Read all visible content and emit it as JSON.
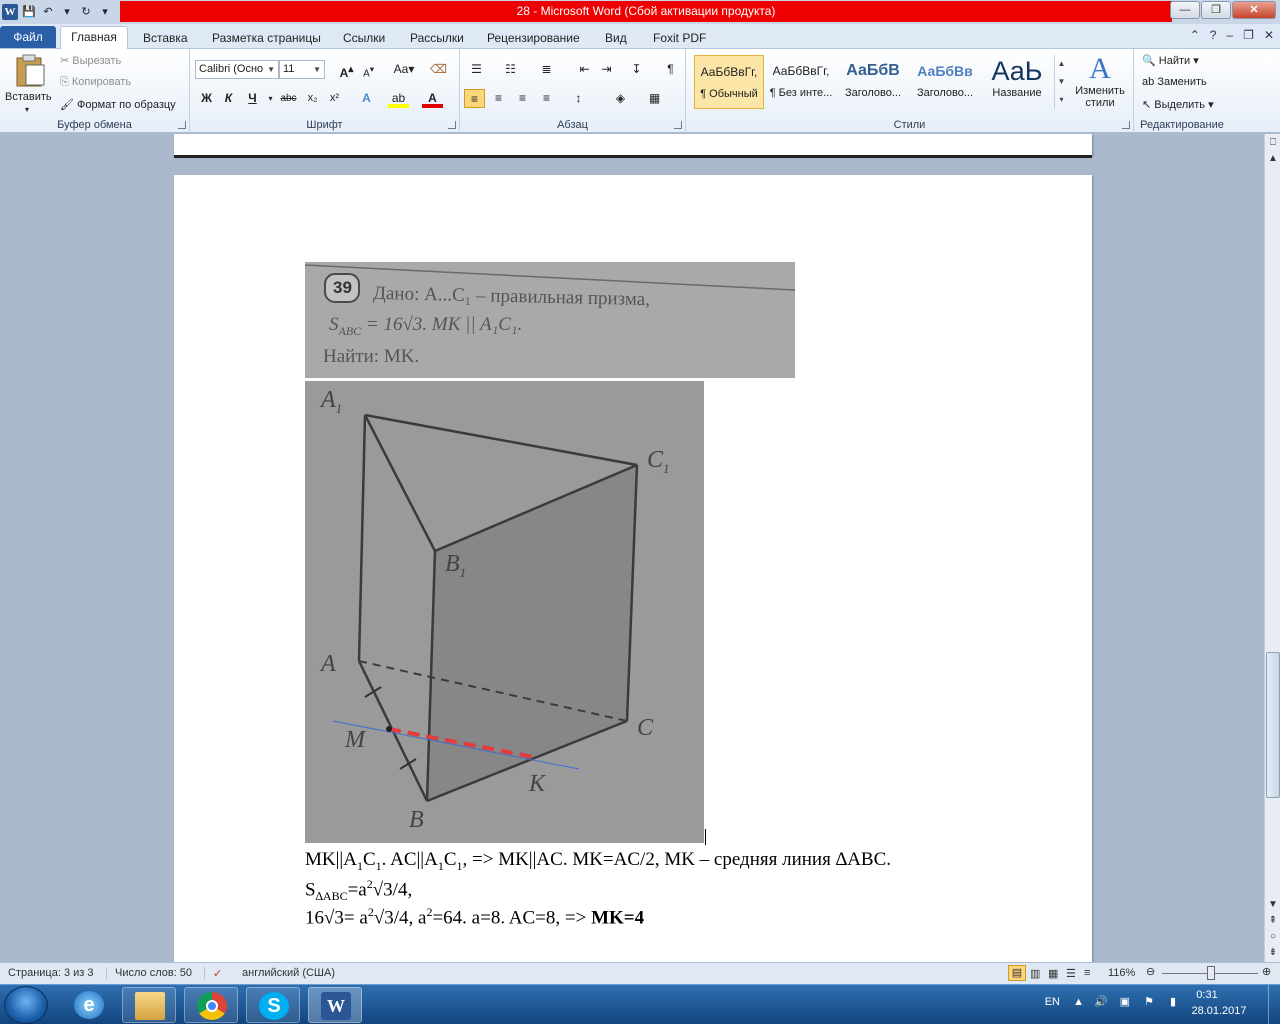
{
  "window": {
    "title": "28 - Microsoft Word (Сбой активации продукта)"
  },
  "qat": {
    "word_icon": "W",
    "save_icon": "💾",
    "undo_icon": "↶",
    "redo_icon": "↻"
  },
  "tabs": {
    "file": "Файл",
    "home": "Главная",
    "insert": "Вставка",
    "layout": "Разметка страницы",
    "references": "Ссылки",
    "mailings": "Рассылки",
    "review": "Рецензирование",
    "view": "Вид",
    "foxit": "Foxit PDF"
  },
  "clipboard": {
    "paste": "Вставить",
    "cut": "Вырезать",
    "copy": "Копировать",
    "format_painter": "Формат по образцу",
    "label": "Буфер обмена"
  },
  "font": {
    "name": "Calibri (Осно",
    "size": "11",
    "label": "Шрифт",
    "bold": "Ж",
    "italic": "К",
    "underline": "Ч",
    "strike": "abc",
    "subscript": "x₂",
    "superscript": "x²",
    "grow": "A",
    "shrink": "A",
    "case": "Aa"
  },
  "paragraph": {
    "label": "Абзац"
  },
  "styles": {
    "label": "Стили",
    "items": [
      {
        "sample": "АаБбВвГг,",
        "name": "¶ Обычный"
      },
      {
        "sample": "АаБбВвГг,",
        "name": "¶ Без инте..."
      },
      {
        "sample": "АаБбВ",
        "name": "Заголово..."
      },
      {
        "sample": "АаБбВв",
        "name": "Заголово..."
      },
      {
        "sample": "АаЬ",
        "name": "Название"
      }
    ],
    "change": "Изменить стили"
  },
  "editing": {
    "find": "Найти",
    "replace": "Заменить",
    "select": "Выделить",
    "label": "Редактирование"
  },
  "document": {
    "line1_a": "MK||A",
    "line1_b": "1",
    "line1_c": "C",
    "line1_d": "1",
    "line1_e": ". AC||A",
    "line1_f": "1",
    "line1_g": "C",
    "line1_h": "1",
    "line1_i": ", => MK||AC. MK=AC/2, MK – средняя линия ∆ABC.",
    "line2_a": "S",
    "line2_b": "∆ABC",
    "line2_c": "=a",
    "line2_d": "2",
    "line2_e": "√3/4,",
    "line3_a": "16√3= a",
    "line3_b": "2",
    "line3_c": "√3/4, a",
    "line3_d": "2",
    "line3_e": "=64. a=8. AC=8, => ",
    "line3_f": "MK=4"
  },
  "problem_image": {
    "number": "39",
    "line1": "Дано: A...C₁ – правильная призма,",
    "line2_a": "S",
    "line2_b": "ABC",
    "line2_c": " = 16√3. MK || A₁C₁.",
    "line3": "Найти: MK."
  },
  "figure": {
    "A1": "A",
    "A1sub": "1",
    "C1": "C",
    "C1sub": "1",
    "B1": "B",
    "B1sub": "1",
    "A": "A",
    "C": "C",
    "M": "M",
    "K": "K",
    "B": "B"
  },
  "status": {
    "page": "Страница: 3 из 3",
    "words": "Число слов: 50",
    "language": "английский (США)",
    "zoom": "116%"
  },
  "tray": {
    "lang": "EN",
    "time": "0:31",
    "date": "28.01.2017"
  }
}
